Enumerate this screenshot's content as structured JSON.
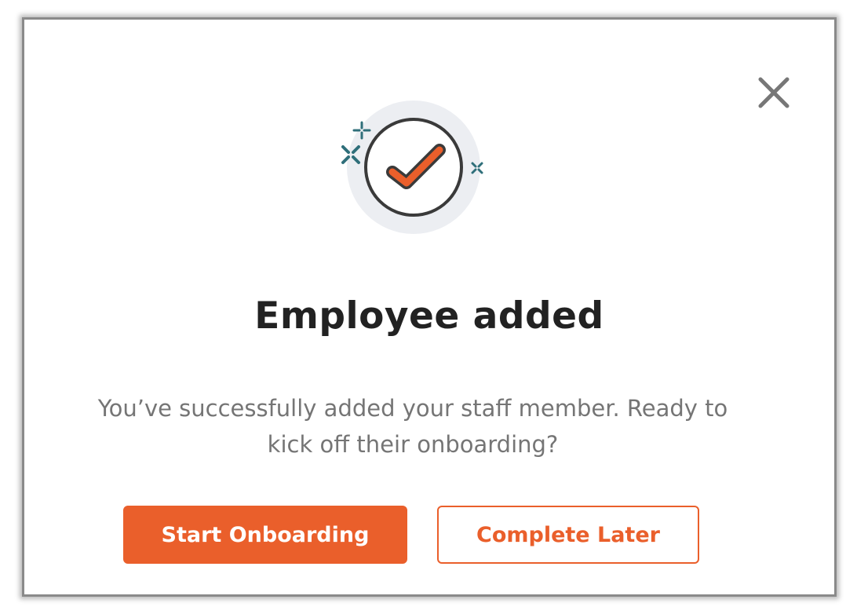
{
  "dialog": {
    "title": "Employee added",
    "message": "You’ve successfully added your staff member. Ready to kick off their onboarding?",
    "close_icon": "close-icon",
    "success_icon": "checkmark-circle-icon",
    "primary_button_label": "Start Onboarding",
    "secondary_button_label": "Complete Later"
  },
  "colors": {
    "accent": "#ea5f2b",
    "title": "#222222",
    "body_text": "#757575",
    "sparkle": "#2f6f7a",
    "halo": "#eceef2",
    "close": "#777777"
  }
}
